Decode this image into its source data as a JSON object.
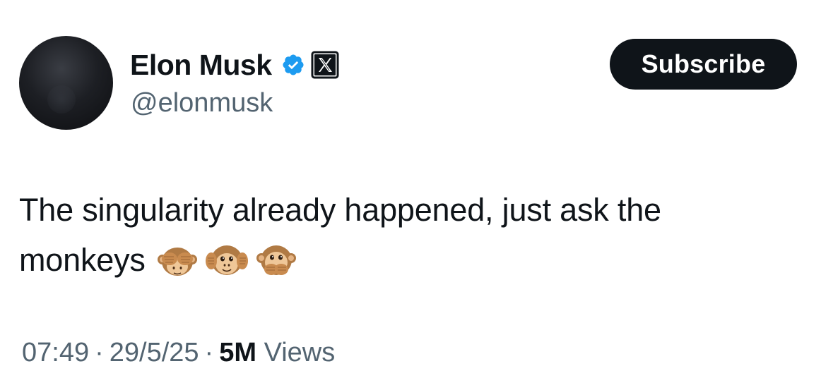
{
  "author": {
    "name": "Elon Musk",
    "handle": "@elonmusk",
    "avatar_icon": "profile-avatar",
    "verified_icon": "blue-verified-check-icon",
    "affiliate_icon": "x-logo-badge-icon",
    "verified_color": "#1d9bf0"
  },
  "actions": {
    "subscribe_label": "Subscribe"
  },
  "tweet": {
    "line1": "The singularity already happened, just ask the",
    "line2": "monkeys",
    "emojis": [
      "see-no-evil-monkey-icon",
      "hear-no-evil-monkey-icon",
      "speak-no-evil-monkey-icon"
    ]
  },
  "meta": {
    "time": "07:49",
    "separator": "·",
    "date": "29/5/25",
    "views_count": "5M",
    "views_label": "Views"
  },
  "colors": {
    "text_primary": "#0f1419",
    "text_secondary": "#536471",
    "button_bg": "#0f1419",
    "button_text": "#ffffff",
    "background": "#ffffff"
  }
}
